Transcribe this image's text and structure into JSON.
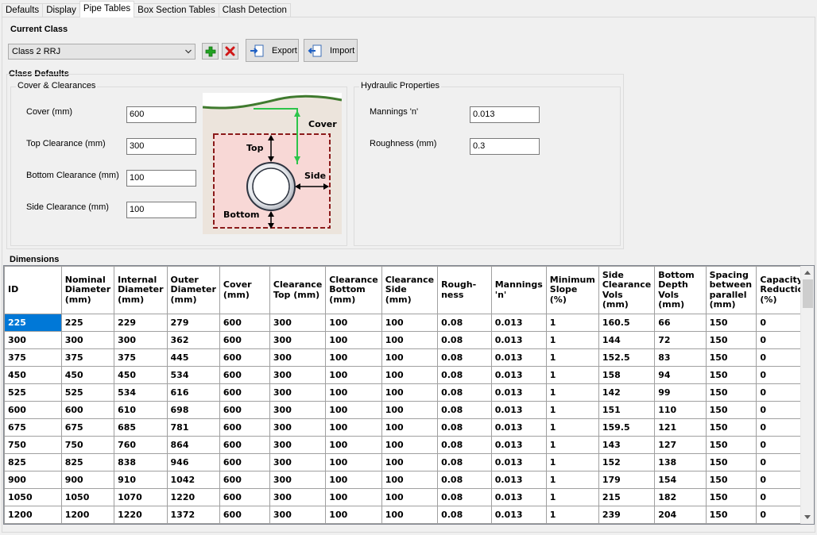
{
  "tabs": [
    "Defaults",
    "Display",
    "Pipe Tables",
    "Box Section Tables",
    "Clash Detection"
  ],
  "current_class": {
    "heading": "Current Class",
    "selected": "Class 2 RRJ",
    "export_label": "Export",
    "import_label": "Import"
  },
  "class_defaults": {
    "heading": "Class Defaults",
    "cover_group": {
      "legend": "Cover & Clearances",
      "cover_label": "Cover (mm)",
      "cover_value": "600",
      "top_label": "Top Clearance (mm)",
      "top_value": "300",
      "bottom_label": "Bottom Clearance (mm)",
      "bottom_value": "100",
      "side_label": "Side Clearance (mm)",
      "side_value": "100"
    },
    "diagram": {
      "cover": "Cover",
      "top": "Top",
      "side": "Side",
      "bottom": "Bottom"
    },
    "hydraulic_group": {
      "legend": "Hydraulic Properties",
      "mannings_label": "Mannings 'n'",
      "mannings_value": "0.013",
      "roughness_label": "Roughness (mm)",
      "roughness_value": "0.3"
    }
  },
  "dimensions": {
    "heading": "Dimensions",
    "columns": [
      "ID",
      "Nominal Diameter (mm)",
      "Internal Diameter (mm)",
      "Outer Diameter (mm)",
      "Cover (mm)",
      "Clearance Top (mm)",
      "Clearance Bottom (mm)",
      "Clearance Side (mm)",
      "Rough- ness",
      "Mannings 'n'",
      "Minimum Slope (%)",
      "Side Clearance Vols (mm)",
      "Bottom Depth Vols (mm)",
      "Spacing between parallel (mm)",
      "Capacity Reduction (%)"
    ],
    "rows": [
      [
        "225",
        "225",
        "229",
        "279",
        "600",
        "300",
        "100",
        "100",
        "0.08",
        "0.013",
        "1",
        "160.5",
        "66",
        "150",
        "0"
      ],
      [
        "300",
        "300",
        "300",
        "362",
        "600",
        "300",
        "100",
        "100",
        "0.08",
        "0.013",
        "1",
        "144",
        "72",
        "150",
        "0"
      ],
      [
        "375",
        "375",
        "375",
        "445",
        "600",
        "300",
        "100",
        "100",
        "0.08",
        "0.013",
        "1",
        "152.5",
        "83",
        "150",
        "0"
      ],
      [
        "450",
        "450",
        "450",
        "534",
        "600",
        "300",
        "100",
        "100",
        "0.08",
        "0.013",
        "1",
        "158",
        "94",
        "150",
        "0"
      ],
      [
        "525",
        "525",
        "534",
        "616",
        "600",
        "300",
        "100",
        "100",
        "0.08",
        "0.013",
        "1",
        "142",
        "99",
        "150",
        "0"
      ],
      [
        "600",
        "600",
        "610",
        "698",
        "600",
        "300",
        "100",
        "100",
        "0.08",
        "0.013",
        "1",
        "151",
        "110",
        "150",
        "0"
      ],
      [
        "675",
        "675",
        "685",
        "781",
        "600",
        "300",
        "100",
        "100",
        "0.08",
        "0.013",
        "1",
        "159.5",
        "121",
        "150",
        "0"
      ],
      [
        "750",
        "750",
        "760",
        "864",
        "600",
        "300",
        "100",
        "100",
        "0.08",
        "0.013",
        "1",
        "143",
        "127",
        "150",
        "0"
      ],
      [
        "825",
        "825",
        "838",
        "946",
        "600",
        "300",
        "100",
        "100",
        "0.08",
        "0.013",
        "1",
        "152",
        "138",
        "150",
        "0"
      ],
      [
        "900",
        "900",
        "910",
        "1042",
        "600",
        "300",
        "100",
        "100",
        "0.08",
        "0.013",
        "1",
        "179",
        "154",
        "150",
        "0"
      ],
      [
        "1050",
        "1050",
        "1070",
        "1220",
        "600",
        "300",
        "100",
        "100",
        "0.08",
        "0.013",
        "1",
        "215",
        "182",
        "150",
        "0"
      ],
      [
        "1200",
        "1200",
        "1220",
        "1372",
        "600",
        "300",
        "100",
        "100",
        "0.08",
        "0.013",
        "1",
        "239",
        "204",
        "150",
        "0"
      ]
    ]
  }
}
